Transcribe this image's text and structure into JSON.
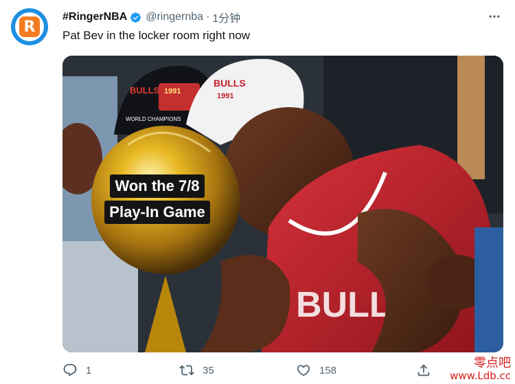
{
  "tweet": {
    "avatar_letter": "R",
    "display_name": "#RingerNBA",
    "handle": "@ringernba",
    "separator": "·",
    "timestamp": "1分钟",
    "text": "Pat Bev in the locker room right now",
    "more_icon": "more-icon"
  },
  "media": {
    "caption_line1": "Won the 7/8",
    "caption_line2": "Play-In Game",
    "hat_text_left": "BULLS",
    "hat_year_left": "1991",
    "hat_sub_left": "WORLD CHAMPIONS",
    "cap_text_right": "BULLS",
    "cap_year_right": "1991",
    "jersey_text": "BULLS"
  },
  "actions": {
    "reply_count": "1",
    "retweet_count": "35",
    "like_count": "158"
  },
  "watermark": {
    "line1": "零点吧",
    "line2": "www.Ldb.cc"
  },
  "colors": {
    "brand_orange": "#f47b20",
    "avatar_ring": "#1e8fe0",
    "verified_blue": "#1d9bf0",
    "secondary_text": "#536471",
    "jersey_red": "#c41e2a",
    "trophy_gold": "#d4a017"
  }
}
